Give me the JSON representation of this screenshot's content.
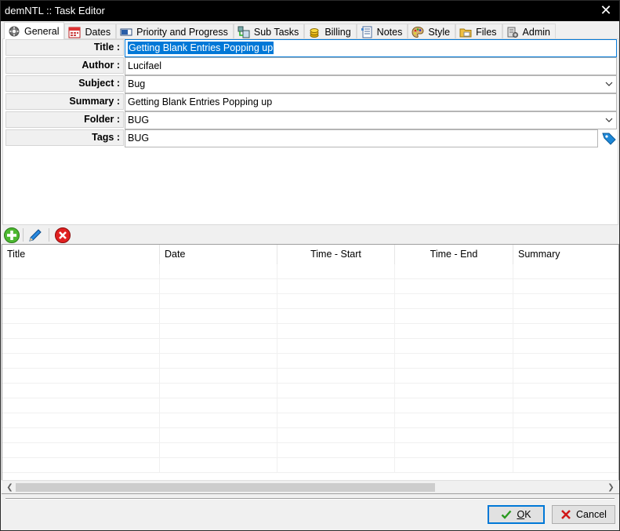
{
  "window": {
    "title": "demNTL :: Task Editor",
    "close_glyph": "✕"
  },
  "tabs": [
    {
      "label": "General",
      "icon": "gear-icon",
      "active": true
    },
    {
      "label": "Dates",
      "icon": "calendar-icon"
    },
    {
      "label": "Priority and Progress",
      "icon": "progress-icon"
    },
    {
      "label": "Sub Tasks",
      "icon": "subtasks-icon"
    },
    {
      "label": "Billing",
      "icon": "coins-icon"
    },
    {
      "label": "Notes",
      "icon": "notes-icon"
    },
    {
      "label": "Style",
      "icon": "palette-icon"
    },
    {
      "label": "Files",
      "icon": "folder-icon"
    },
    {
      "label": "Admin",
      "icon": "admin-icon"
    }
  ],
  "fields": {
    "title": {
      "label": "Title :",
      "value": "Getting Blank Entries Popping up"
    },
    "author": {
      "label": "Author :",
      "value": "Lucifael"
    },
    "subject": {
      "label": "Subject :",
      "value": "Bug"
    },
    "summary": {
      "label": "Summary :",
      "value": "Getting Blank Entries Popping up"
    },
    "folder": {
      "label": "Folder :",
      "value": "BUG"
    },
    "tags": {
      "label": "Tags :",
      "value": "BUG"
    }
  },
  "grid": {
    "columns": [
      "Title",
      "Date",
      "Time - Start",
      "Time - End",
      "Summary"
    ],
    "rows": []
  },
  "buttons": {
    "ok": {
      "prefix": "",
      "mnemonic": "O",
      "rest": "K"
    },
    "cancel": {
      "label": "Cancel"
    }
  },
  "colors": {
    "accent": "#0078d7",
    "titlebar": "#000000"
  }
}
